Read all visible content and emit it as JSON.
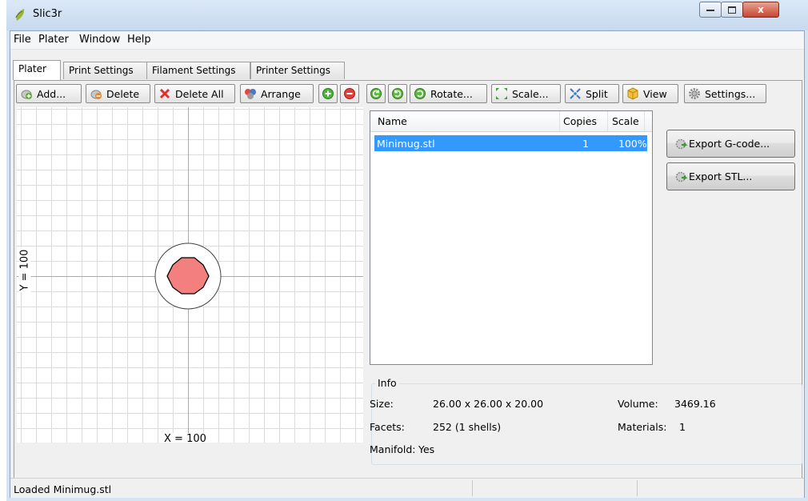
{
  "window": {
    "title": "Slic3r",
    "close_glyph": "x"
  },
  "menu": [
    {
      "label": "File"
    },
    {
      "label": "Plater"
    },
    {
      "label": "Window"
    },
    {
      "label": "Help"
    }
  ],
  "tabs": [
    {
      "label": "Plater",
      "active": true
    },
    {
      "label": "Print Settings"
    },
    {
      "label": "Filament Settings"
    },
    {
      "label": "Printer Settings"
    }
  ],
  "toolbar": {
    "add": "Add...",
    "delete": "Delete",
    "delete_all": "Delete All",
    "arrange": "Arrange",
    "rotate": "Rotate...",
    "scale": "Scale...",
    "split": "Split",
    "view": "View",
    "settings": "Settings..."
  },
  "plater": {
    "y_label": "Y = 100",
    "x_label": "X = 100",
    "object_color": "#f47f7f"
  },
  "object_list": {
    "columns": [
      "Name",
      "Copies",
      "Scale"
    ],
    "rows": [
      {
        "name": "Minimug.stl",
        "copies": "1",
        "scale": "100%",
        "selected": true
      }
    ]
  },
  "actions": {
    "export_gcode": "Export G-code...",
    "export_stl": "Export STL..."
  },
  "info": {
    "title": "Info",
    "size_label": "Size:",
    "size_value": "26.00 x 26.00 x 20.00",
    "facets_label": "Facets:",
    "facets_value": "252 (1 shells)",
    "manifold_label": "Manifold:",
    "manifold_value": "Yes",
    "volume_label": "Volume:",
    "volume_value": "3469.16",
    "materials_label": "Materials:",
    "materials_value": "1"
  },
  "status": {
    "text": "Loaded Minimug.stl"
  },
  "colors": {
    "selection": "#3399ff",
    "title_bar": "#c7d9ef",
    "close_button": "#c7462f"
  }
}
